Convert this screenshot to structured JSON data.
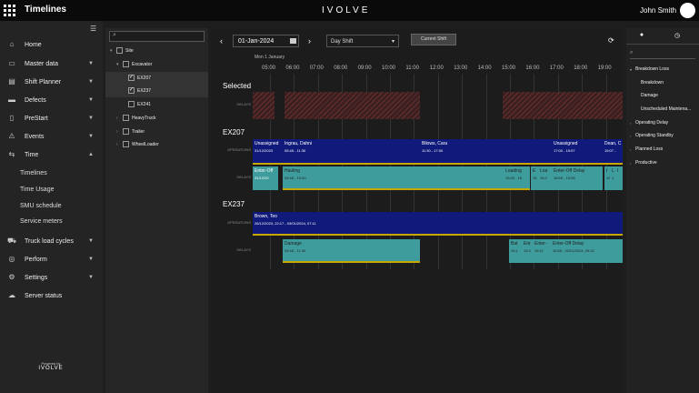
{
  "app": {
    "title": "Timelines",
    "logo": "IVOLVE",
    "user": "John Smith"
  },
  "nav": {
    "items": [
      {
        "label": "Home",
        "icon": "⌂"
      },
      {
        "label": "Master data",
        "icon": "▭"
      },
      {
        "label": "Shift Planner",
        "icon": "▤"
      },
      {
        "label": "Defects",
        "icon": "▬"
      },
      {
        "label": "PreStart",
        "icon": "▯"
      },
      {
        "label": "Events",
        "icon": "⚠"
      },
      {
        "label": "Time",
        "icon": "⇆"
      },
      {
        "label": "Truck load cycles",
        "icon": "⛟"
      },
      {
        "label": "Perform",
        "icon": "◎"
      },
      {
        "label": "Settings",
        "icon": "⚙"
      },
      {
        "label": "Server status",
        "icon": "☁"
      }
    ],
    "time_sub": [
      "Timelines",
      "Time Usage",
      "SMU schedule",
      "Service meters"
    ],
    "powered": "Powered by",
    "powered_logo": "IVOLVE"
  },
  "tree": {
    "items": [
      "Site",
      "Excavator",
      "EX207",
      "EX237",
      "EX241",
      "HeavyTruck",
      "Trailer",
      "WheelLoader"
    ]
  },
  "toolbar": {
    "date": "01-Jan-2024",
    "shift": "Day Shift",
    "current": "Current Shift"
  },
  "timeline": {
    "day": "Mon 1 January",
    "hours": [
      "05:00",
      "06:00",
      "07:00",
      "08:00",
      "09:00",
      "10:00",
      "11:00",
      "12:00",
      "13:00",
      "14:00",
      "15:00",
      "16:00",
      "17:00",
      "18:00",
      "19:00"
    ],
    "selected": "Selected",
    "delays": "DELAYS",
    "operations": "OPERATIONS",
    "ex207": "EX207",
    "ex237": "EX237",
    "ex207_ops": [
      {
        "t1": "Unassigned",
        "t2": "31/12/2023"
      },
      {
        "t1": "Ingrau, Dahni",
        "t2": "05:45 - 11:30"
      },
      {
        "t1": "Bilows, Cara",
        "t2": "11:30 - 17:00"
      },
      {
        "t1": "Unassigned",
        "t2": "17:00 - 19:07"
      },
      {
        "t1": "Dean, C",
        "t2": "19:07 -"
      }
    ],
    "ex207_delays": [
      {
        "t1": "Enter-Off",
        "t2": "31/12/20"
      },
      {
        "t1": "Hauling",
        "t2": "05:45 - 15:00"
      },
      {
        "t1": "Loading",
        "t2": "15:00 - 16"
      },
      {
        "t1": "E",
        "t2": "16"
      },
      {
        "t1": "Loa",
        "t2": "16:2"
      },
      {
        "t1": "Enter-Off Delay",
        "t2": "16:59 - 19:08"
      },
      {
        "t1": "I",
        "t2": "19"
      },
      {
        "t1": "L",
        "t2": "1"
      },
      {
        "t1": "I",
        "t2": ""
      }
    ],
    "ex237_ops": [
      {
        "t1": "Brown, Teo",
        "t2": "26/12/2023, 22:17 - 03/01/2024, 07:11"
      }
    ],
    "ex237_delays": [
      {
        "t1": "Damage",
        "t2": "05:45 - 11:30"
      },
      {
        "t1": "Bat",
        "t2": "15:1"
      },
      {
        "t1": "Ent",
        "t2": "15:4"
      },
      {
        "t1": "Enter-",
        "t2": "16:11"
      },
      {
        "t1": "Enter-Off Delay",
        "t2": "16:55 - 02/01/2024, 05:32"
      }
    ]
  },
  "right": {
    "items": [
      "Breakdown Loss",
      "Breakdown",
      "Damage",
      "Unscheduled Maintena...",
      "Operating Delay",
      "Operating Standby",
      "Planned Loss",
      "Productive"
    ]
  },
  "colors": {
    "operations": "#101a7a",
    "delay": "#3f9c9c",
    "accent": "#c8a800"
  }
}
